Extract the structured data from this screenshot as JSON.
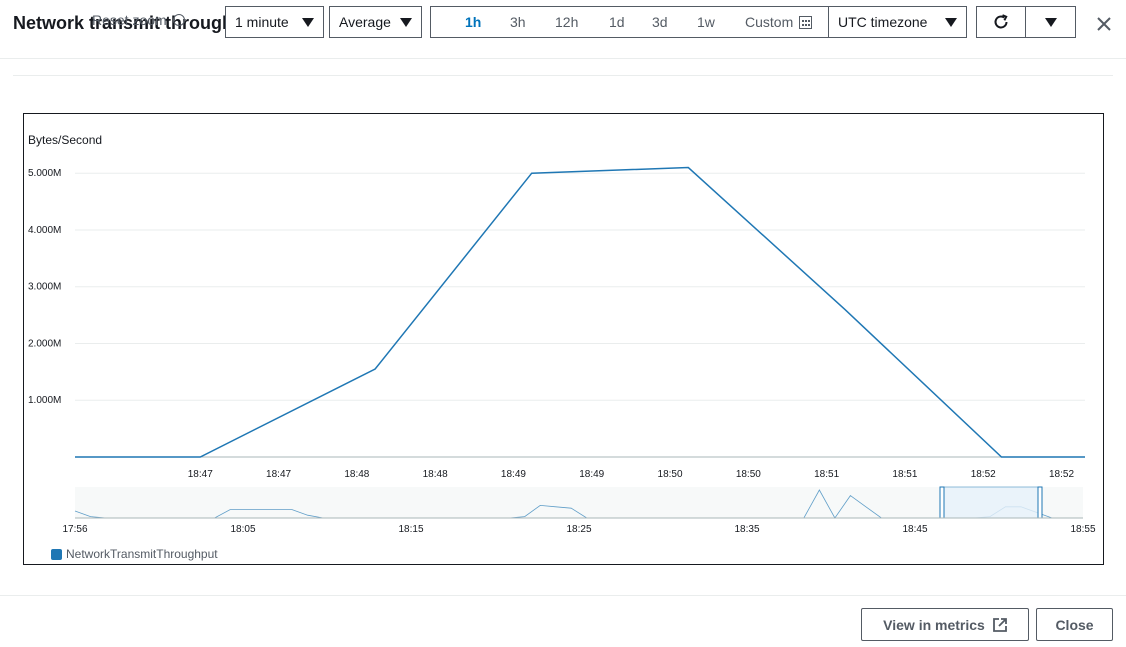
{
  "header": {
    "title": "Network transmit throughput",
    "reset_zoom": "Reset zoom",
    "period_value": "1 minute",
    "statistic_value": "Average",
    "time_ranges": [
      "1h",
      "3h",
      "12h",
      "1d",
      "3d",
      "1w"
    ],
    "active_range": "1h",
    "custom_label": "Custom",
    "timezone_value": "UTC timezone"
  },
  "icons": {
    "zoom": "zoom-out-icon",
    "calendar": "calendar-icon",
    "refresh": "refresh-icon",
    "close": "close-icon",
    "external": "external-link-icon"
  },
  "colors": {
    "series": "#1f77b4",
    "active_range": "#0073bb",
    "navigator_window": "#e8f2fb"
  },
  "chart_data": {
    "type": "line",
    "ylabel": "Bytes/Second",
    "y_ticks": [
      "1.000M",
      "2.000M",
      "3.000M",
      "4.000M",
      "5.000M"
    ],
    "ylim": [
      0,
      5250000
    ],
    "x_tick_labels": [
      "18:47",
      "18:47",
      "18:48",
      "18:48",
      "18:49",
      "18:49",
      "18:50",
      "18:50",
      "18:51",
      "18:51",
      "18:52",
      "18:52"
    ],
    "series": [
      {
        "name": "NetworkTransmitThroughput",
        "x": [
          "18:46:05",
          "18:46:53",
          "18:48:00",
          "18:49:00",
          "18:50:00",
          "18:51:00",
          "18:52:00",
          "18:52:32"
        ],
        "values": [
          0,
          0,
          1550000,
          5000000,
          5100000,
          2600000,
          0,
          0
        ]
      }
    ],
    "grid": true,
    "legend": "bottom-left",
    "navigator": {
      "x_tick_labels": [
        "17:56",
        "18:05",
        "18:15",
        "18:25",
        "18:35",
        "18:45",
        "18:55"
      ],
      "values": [
        0.25,
        0.05,
        0,
        0,
        0,
        0,
        0,
        0,
        0,
        0,
        0.3,
        0.3,
        0.3,
        0.3,
        0.3,
        0.1,
        0,
        0,
        0,
        0,
        0,
        0,
        0,
        0,
        0,
        0,
        0,
        0,
        0,
        0.05,
        0.45,
        0.4,
        0.35,
        0,
        0,
        0,
        0,
        0,
        0,
        0,
        0,
        0,
        0,
        0,
        0,
        0,
        0,
        0,
        1.0,
        0,
        0.8,
        0.4,
        0,
        0,
        0,
        0,
        0,
        0,
        0,
        0.05,
        0.4,
        0.4,
        0.2,
        0,
        0,
        0
      ]
    }
  },
  "footer": {
    "view_in_metrics": "View in metrics",
    "close": "Close"
  }
}
